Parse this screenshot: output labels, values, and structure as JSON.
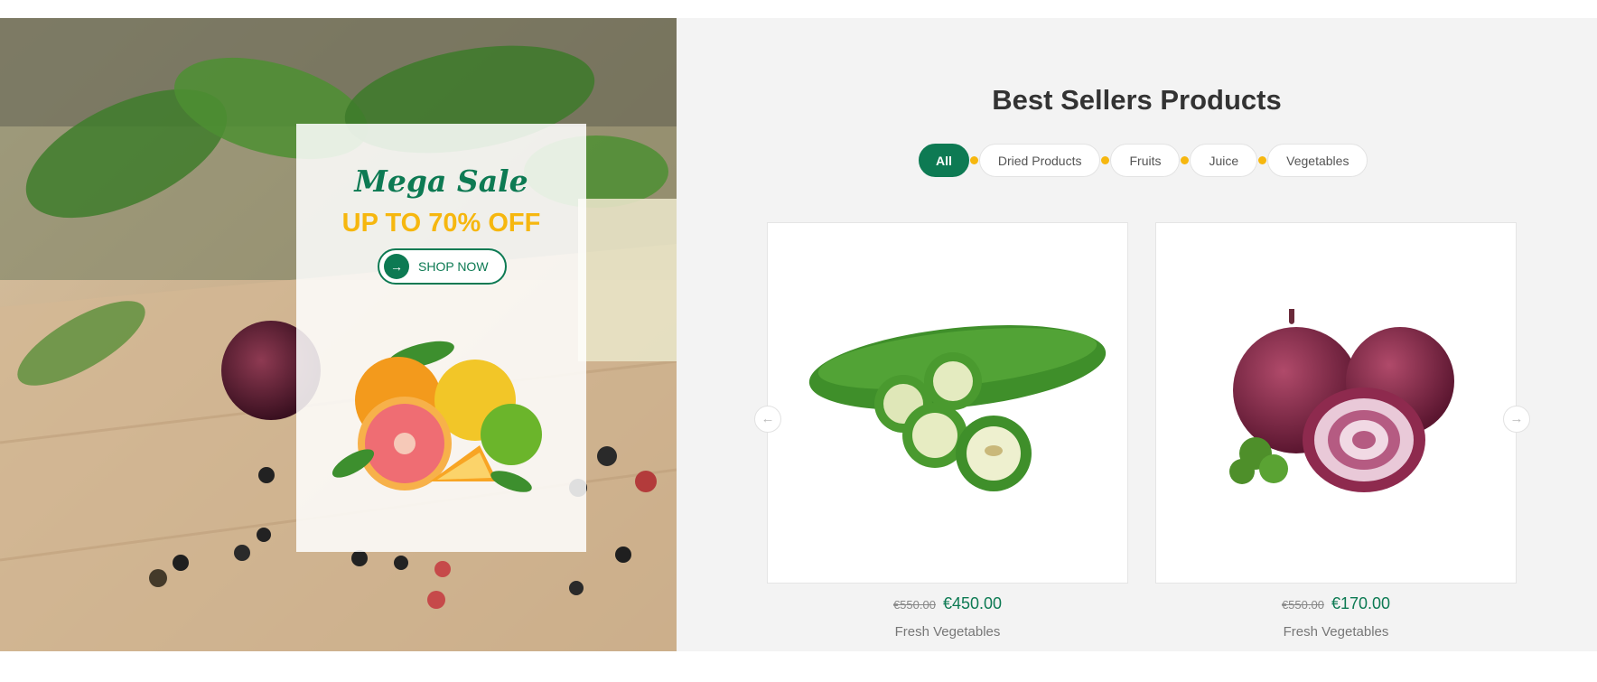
{
  "promo": {
    "headline": "Mega Sale",
    "offer": "UP TO 70% OFF",
    "button_label": "SHOP NOW",
    "button_icon": "arrow-right-icon"
  },
  "products_section": {
    "title": "Best Sellers Products",
    "tabs": [
      {
        "label": "All",
        "active": true
      },
      {
        "label": "Dried Products",
        "active": false
      },
      {
        "label": "Fruits",
        "active": false
      },
      {
        "label": "Juice",
        "active": false
      },
      {
        "label": "Vegetables",
        "active": false
      }
    ],
    "items": [
      {
        "image": "bitter-gourd",
        "old_price": "€550.00",
        "new_price": "€450.00",
        "name": "Fresh Vegetables"
      },
      {
        "image": "red-onion",
        "old_price": "€550.00",
        "new_price": "€170.00",
        "name": "Fresh Vegetables"
      }
    ],
    "prev_icon": "arrow-left-icon",
    "next_icon": "arrow-right-icon"
  },
  "colors": {
    "accent_green": "#0d7a53",
    "accent_yellow": "#f6b70f",
    "section_bg": "#f3f3f3"
  }
}
